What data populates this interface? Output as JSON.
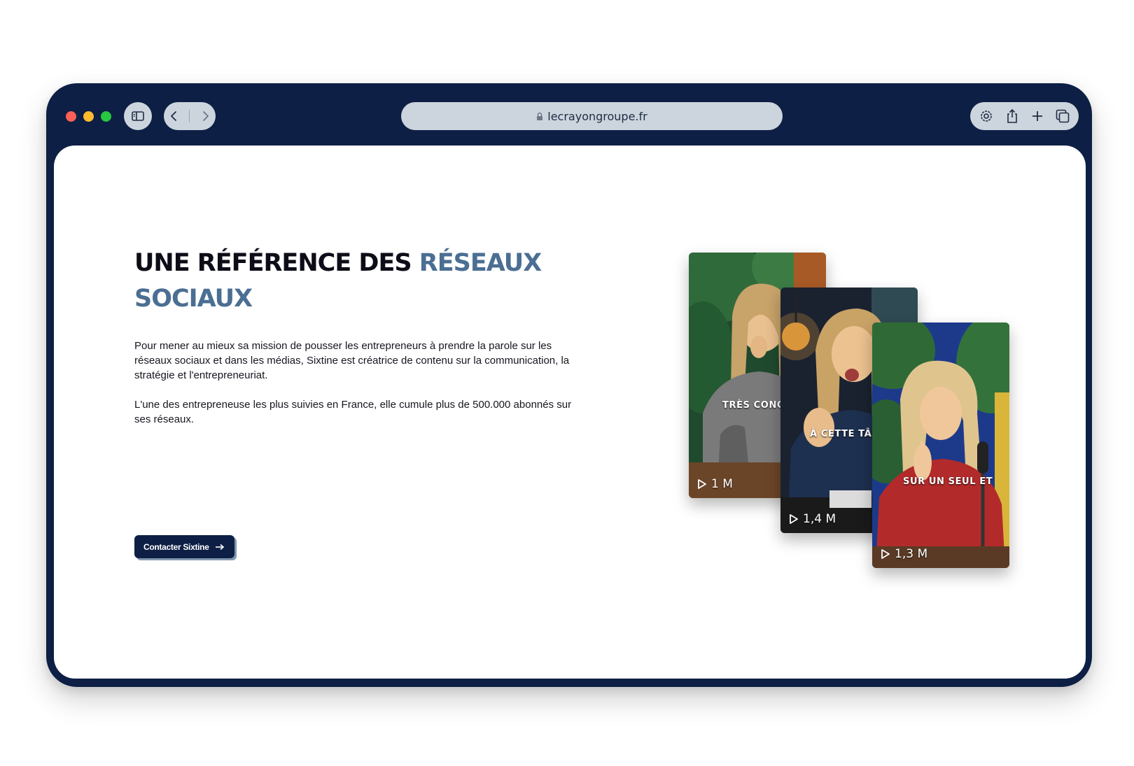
{
  "browser": {
    "url": "lecrayongroupe.fr",
    "icons": [
      "sidebar-icon",
      "chevron-left-icon",
      "chevron-right-icon",
      "lock-icon",
      "settings-icon",
      "share-icon",
      "plus-icon",
      "tabs-icon"
    ]
  },
  "hero": {
    "heading_part1": "UNE RÉFÉRENCE DES ",
    "heading_accent": "RÉSEAUX SOCIAUX",
    "paragraph1": "Pour mener au mieux sa mission de pousser les entrepreneurs à prendre la parole sur les réseaux sociaux et dans les médias, Sixtine est créatrice de contenu sur la communication, la stratégie et l'entrepreneuriat.",
    "paragraph2": "L'une des entrepreneuse les plus suivies en France, elle cumule plus de 500.000 abonnés sur ses réseaux.",
    "cta_label": "Contacter Sixtine"
  },
  "videos": [
    {
      "caption": "TRÈS CONCR",
      "views": "1 M"
    },
    {
      "caption": "À CETTE TÂC",
      "views": "1,4 M"
    },
    {
      "caption": "SUR UN SEUL ET",
      "views": "1,3 M"
    }
  ],
  "colors": {
    "frame": "#0d1f44",
    "accent": "#4b6e93",
    "pill": "#ccd4dd",
    "button_shadow": "#7f96ae"
  }
}
